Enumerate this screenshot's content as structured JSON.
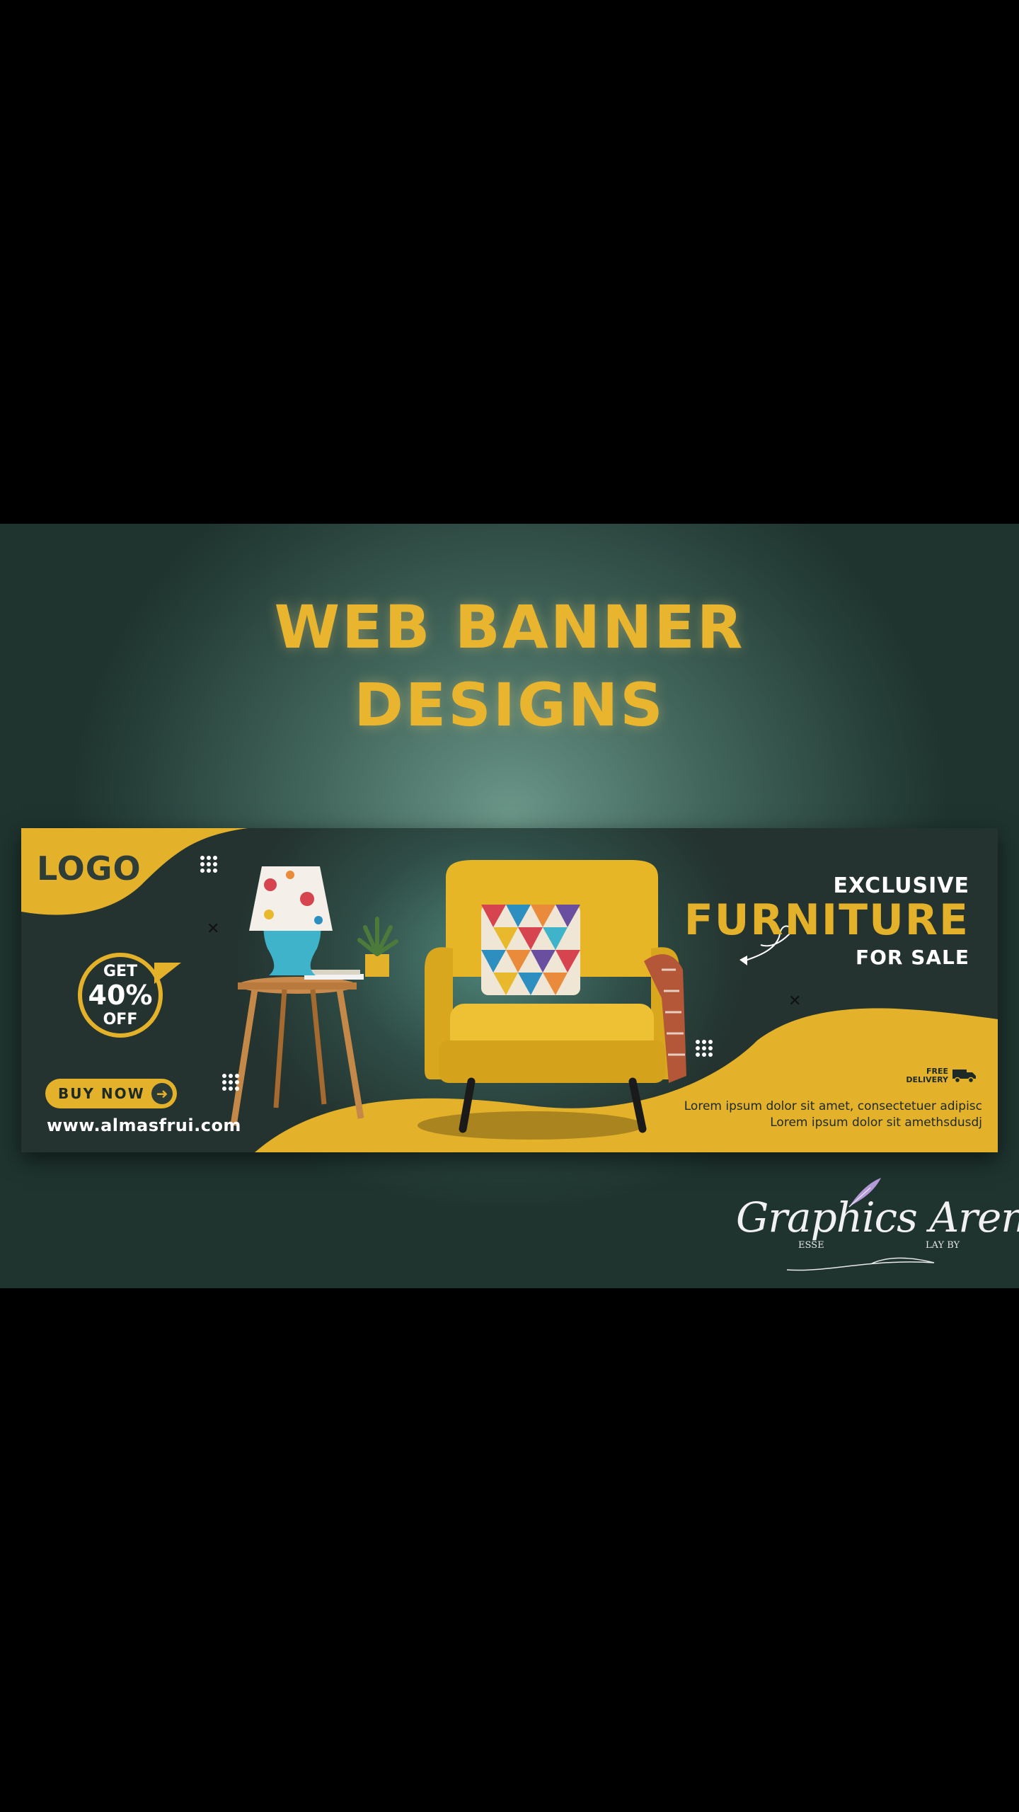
{
  "headline": {
    "line1": "WEB BANNER",
    "line2": "DESIGNS"
  },
  "banner": {
    "logo_text": "LOGO",
    "discount": {
      "get": "GET",
      "percent": "40%",
      "off": "OFF"
    },
    "buy_button_label": "BUY NOW",
    "website": "www.almasfrui.com",
    "title": {
      "line1": "EXCLUSIVE",
      "line2": "FURNITURE",
      "line3": "FOR SALE"
    },
    "delivery": {
      "line1": "FREE",
      "line2": "DELIVERY"
    },
    "body": {
      "line1": "Lorem ipsum dolor sit amet, consectetuer adipisc",
      "line2": "Lorem ipsum dolor sit amethsdusdj"
    }
  },
  "signature": {
    "main": "Graphics Arena",
    "left": "ESSE",
    "right": "LAY BY"
  },
  "colors": {
    "accent": "#e3b12a",
    "dark_green": "#2f4d46",
    "background": "#000000"
  }
}
